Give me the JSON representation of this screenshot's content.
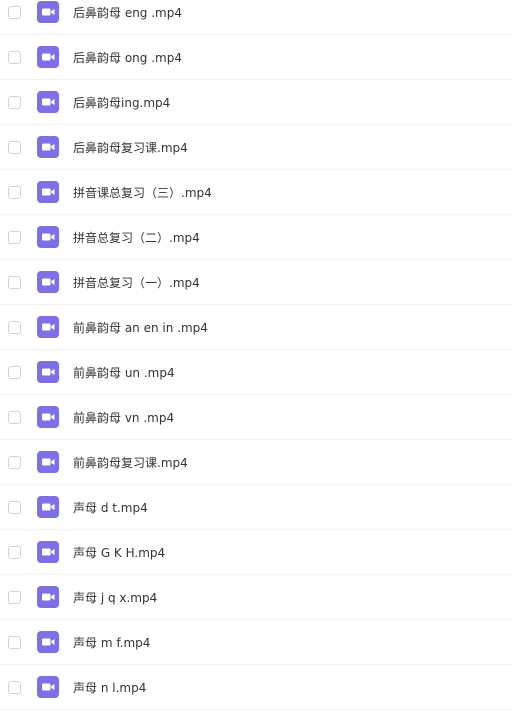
{
  "file_list": {
    "icon": "video-file-icon",
    "icon_color": "#7b70e6",
    "items": [
      {
        "name": "后鼻韵母 eng .mp4"
      },
      {
        "name": "后鼻韵母 ong .mp4"
      },
      {
        "name": "后鼻韵母ing.mp4"
      },
      {
        "name": "后鼻韵母复习课.mp4"
      },
      {
        "name": "拼音课总复习（三）.mp4"
      },
      {
        "name": "拼音总复习（二）.mp4"
      },
      {
        "name": "拼音总复习（一）.mp4"
      },
      {
        "name": "前鼻韵母 an en in .mp4"
      },
      {
        "name": "前鼻韵母 un .mp4"
      },
      {
        "name": "前鼻韵母 vn .mp4"
      },
      {
        "name": "前鼻韵母复习课.mp4"
      },
      {
        "name": "声母 d t.mp4"
      },
      {
        "name": "声母 G K H.mp4"
      },
      {
        "name": "声母 j q x.mp4"
      },
      {
        "name": "声母 m f.mp4"
      },
      {
        "name": "声母 n l.mp4"
      }
    ]
  }
}
